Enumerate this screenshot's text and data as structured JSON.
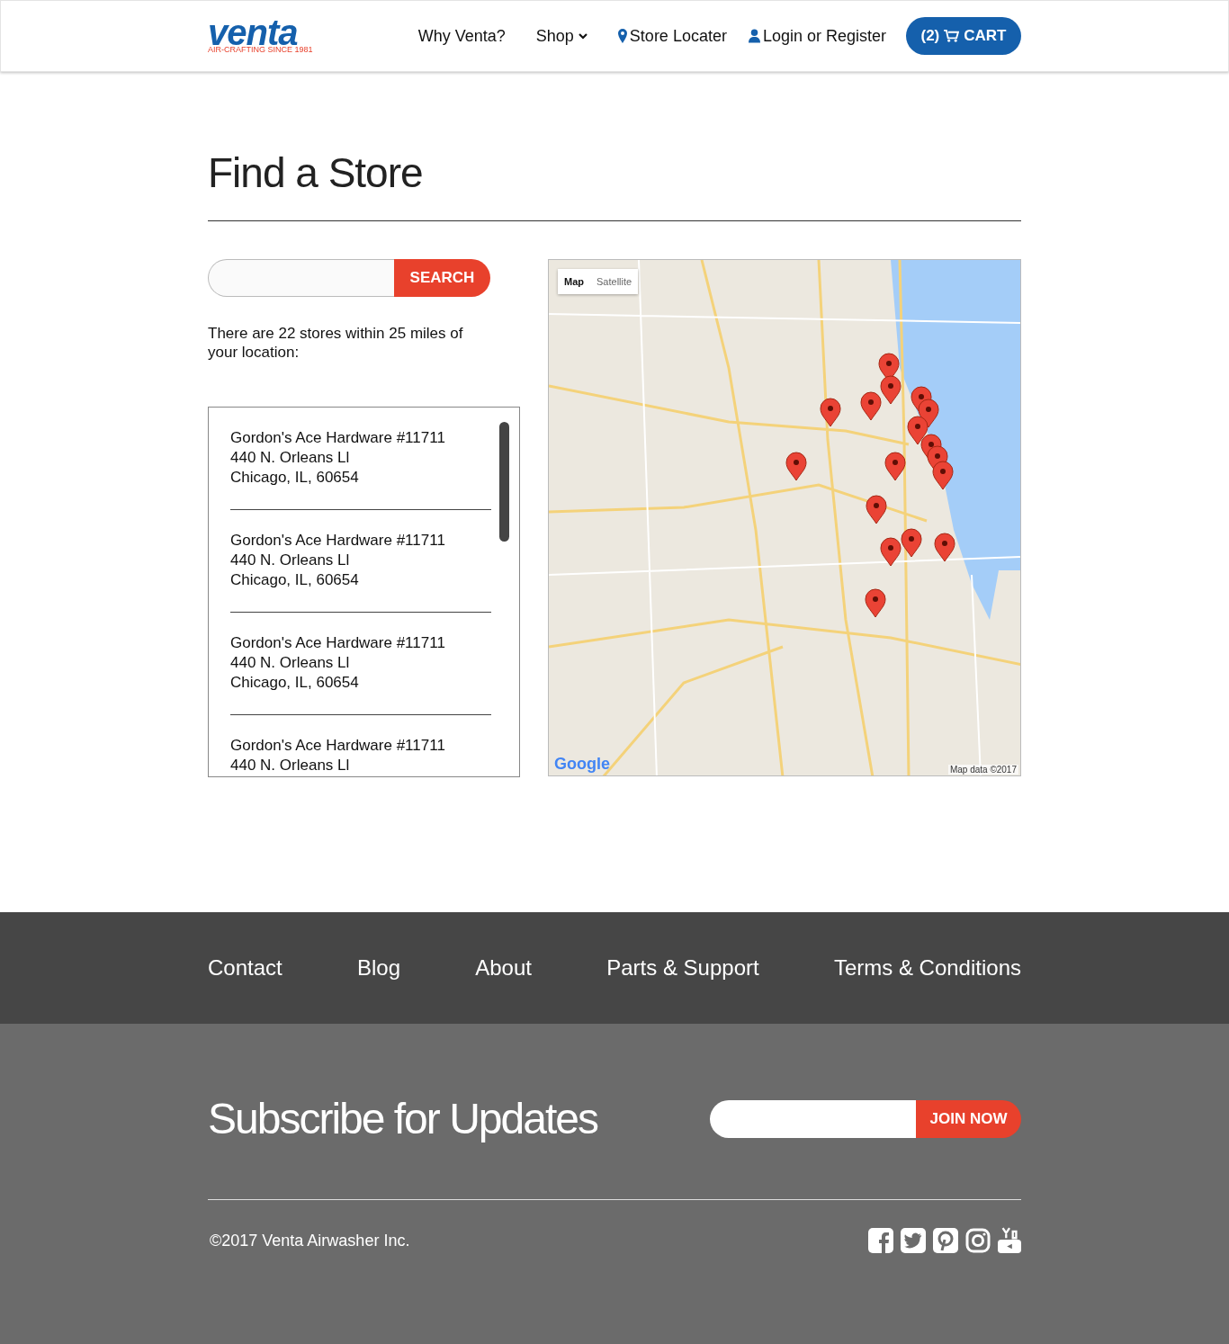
{
  "header": {
    "logo": {
      "wordmark": "venta",
      "tagline": "AIR-CRAFTING SINCE 1981"
    },
    "nav": [
      {
        "label": "Why Venta?",
        "kind": "plain"
      },
      {
        "label": "Shop",
        "kind": "dropdown"
      },
      {
        "label": "Store Locater",
        "kind": "pin"
      },
      {
        "label": "Login or Register",
        "kind": "user"
      }
    ],
    "cart": {
      "count": "(2)",
      "label": "CART"
    }
  },
  "title": "Find a Store",
  "search": {
    "button": "SEARCH"
  },
  "result_text": "There are 22 stores within 25 miles of your location:",
  "stores": [
    {
      "lines": [
        "Gordon's Ace Hardware #11711",
        "440 N. Orleans Ll",
        "Chicago, IL, 60654"
      ]
    },
    {
      "lines": [
        "Gordon's Ace Hardware #11711",
        "440 N. Orleans Ll",
        "Chicago, IL, 60654"
      ]
    },
    {
      "lines": [
        "Gordon's Ace Hardware #11711",
        "440 N. Orleans Ll",
        "Chicago, IL, 60654"
      ]
    },
    {
      "lines": [
        "Gordon's Ace Hardware #11711",
        "440 N. Orleans Ll"
      ]
    }
  ],
  "map": {
    "tabs": [
      {
        "label": "Map",
        "selected": true
      },
      {
        "label": "Satellite",
        "selected": false
      }
    ],
    "brand": "Google",
    "attribution": "Map data ©2017"
  },
  "footer_links": [
    "Contact",
    "Blog",
    "About",
    "Parts & Support",
    "Terms & Conditions"
  ],
  "subscribe": {
    "title": "Subscribe for Updates",
    "button": "JOIN NOW"
  },
  "copyright": "©2017 Venta Airwasher Inc.",
  "social": [
    {
      "kind": "facebook"
    },
    {
      "kind": "twitter"
    },
    {
      "kind": "pinterest"
    },
    {
      "kind": "instagram"
    },
    {
      "kind": "youtube"
    }
  ]
}
